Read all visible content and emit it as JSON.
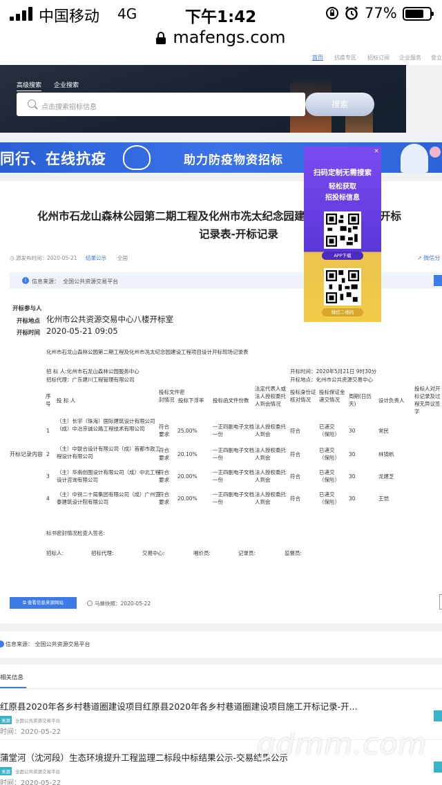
{
  "status_bar": {
    "carrier": "中国移动",
    "network": "4G",
    "time": "下午1:42",
    "battery": "77%",
    "battery_level": 0.77
  },
  "browser": {
    "url": "mafengs.com"
  },
  "site_nav": {
    "items": [
      "首页",
      "抗疫专区",
      "招标订阅",
      "企业服务",
      "會立"
    ]
  },
  "search": {
    "tabs": [
      "高级搜索",
      "企业搜索"
    ],
    "placeholder": "点击搜索招标信息",
    "button": "搜索"
  },
  "banner": {
    "left_text": "同行、在线抗疫",
    "right_text": "助力防疫物资招标"
  },
  "qr_popup": {
    "line1": "扫码定制无需搜索",
    "line2": "轻松获取",
    "line3": "招投标信息",
    "app_label": "APP下载",
    "wechat_label": "微信二维码",
    "close": "×"
  },
  "article": {
    "title_line1": "化州市石龙山森林公园第二期工程及化州市冼太纪念园建设工程项目设计开标",
    "title_line2": "记录表-开标记录",
    "publish_time": "源发布时间：2020-05-21",
    "category": "结果公示",
    "region": "全国",
    "share": "微信分",
    "source_label": "信息来源：",
    "source_value": "全国公共资源交易平台",
    "participants_label": "开标参与人",
    "location_label": "开标地点",
    "location_value": "化州市公共资源交易中心八楼开标室",
    "time_label": "开标时间",
    "time_value": "2020-05-21 09:05",
    "record_label": "开标记录内容",
    "record_title": "化州市石龙山森林公园第二期工程及化州市冼太纪念园建设工程项目设计开标现场记录表",
    "tenderer": "招 标 人:化州市石龙山森林公园服务中心",
    "agent": "招标代理：广东建川工程管理有限公司",
    "open_time": "开标时间：2020年5月21日 9时30分",
    "open_place": "开标地点：化州市公共资源交易中心",
    "table_headers": [
      "序号",
      "投 标 人",
      "投标文件密封情况",
      "投标下浮率",
      "投标函文件份数",
      "法定代表人或法人授权委托人到会情况",
      "投标身份证核对情况",
      "投标保证金递交情况",
      "周期(日历天)",
      "设计负责人",
      "投标人对开标记录及过程无异议签字"
    ],
    "rows": [
      {
        "no": "1",
        "bidder": "（主）长宇（珠海）国际建筑设计有限公司（成）中冶京诚公路工程技术有限公司",
        "seal": "符合要求",
        "rate": "25.00%",
        "copies": "一正四副电子文档一份",
        "rep": "法人授权委托人到会",
        "id": "符合",
        "deposit": "已递交（保险）",
        "period": "30",
        "lead": "常民"
      },
      {
        "no": "2",
        "bidder": "（主）中联合设计有限公司（成）首都市政工程设计有限公司",
        "seal": "符合要求",
        "rate": "20.10%",
        "copies": "一正四副电子文档一份",
        "rep": "法人授权委托人到会",
        "id": "符合",
        "deposit": "已递交（保险）",
        "period": "30",
        "lead": "林锦帆"
      },
      {
        "no": "3",
        "bidder": "（主）华南创图设计有限公司（成）中北工程设计咨询有限公司",
        "seal": "符合要求",
        "rate": "20.00%",
        "copies": "一正四副电子文档一份",
        "rep": "法人授权委托人到会",
        "id": "符合",
        "deposit": "已递交（保险）",
        "period": "30",
        "lead": "龙建芝"
      },
      {
        "no": "4",
        "bidder": "（主）中铁二十局集团有限公司（成）广州亚泰建筑设计院有限公司",
        "seal": "符合要求",
        "rate": "20.00%",
        "copies": "一正四副电子文档一份",
        "rep": "法人授权委托人到会",
        "id": "符合",
        "deposit": "已递交（保险）",
        "period": "30",
        "lead": "王恺"
      }
    ],
    "seal_check": "标书密封情况检查人签名:",
    "signers": [
      "招标人:",
      "招标代理:",
      "交易中心:",
      "唱价员:",
      "记录员:",
      "监督员:"
    ],
    "view_source_button": "查看信息来源网站",
    "mafeng_snapshot": "马蜂快照：2020-05-22"
  },
  "info_source": "信息来源：  全国公共资源交易平台",
  "related": {
    "heading": "相关信息",
    "items": [
      {
        "title": "红原县2020年各乡村巷道圈建设项目红原县2020年各乡村巷道圈建设项目施工开标记录-开...",
        "tag": "来源",
        "source": "全国公共资源交易平台",
        "date": "时间：2020-05-22"
      },
      {
        "title": "蒲堂河（沈河段）生态环境提升工程监理二标段中标结果公示-交易结果公示",
        "tag": "来源",
        "source": "全国公共资源交易平台",
        "date": "时间：2020-05-22"
      }
    ]
  },
  "watermark": "gdmm.com",
  "colors": {
    "accent": "#3d7be6",
    "banner": "#2a5fd6",
    "popup_purple": "#6a40e6",
    "popup_yellow": "#f2cc49"
  }
}
